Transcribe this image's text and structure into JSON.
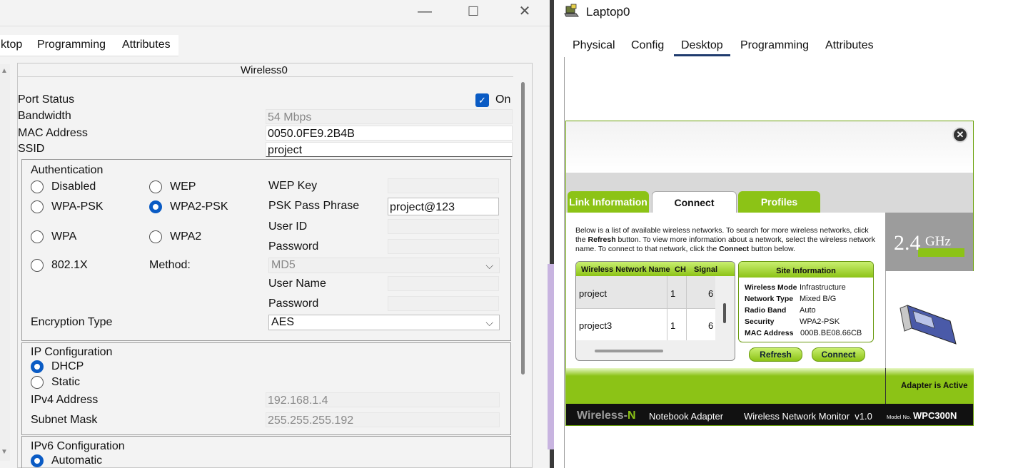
{
  "left_window": {
    "controls": {
      "minimize": "—",
      "maximize": "☐",
      "close": "✕"
    },
    "tabs": [
      "ktop",
      "Programming",
      "Attributes"
    ],
    "panel_title": "Wireless0",
    "port_status": {
      "label": "Port Status",
      "checked": true,
      "value": "On"
    },
    "bandwidth": {
      "label": "Bandwidth",
      "value": "54 Mbps"
    },
    "mac": {
      "label": "MAC Address",
      "value": "0050.0FE9.2B4B"
    },
    "ssid": {
      "label": "SSID",
      "value": "project"
    },
    "auth": {
      "title": "Authentication",
      "options": [
        "Disabled",
        "WEP",
        "WPA-PSK",
        "WPA2-PSK",
        "WPA",
        "WPA2",
        "802.1X"
      ],
      "selected": "WPA2-PSK",
      "wep_key_label": "WEP Key",
      "psk_label": "PSK Pass Phrase",
      "psk_value": "project@123",
      "user_id_label": "User ID",
      "password_label": "Password",
      "method_label": "Method:",
      "method_value": "MD5",
      "user_name_label": "User Name",
      "password2_label": "Password"
    },
    "encryption": {
      "label": "Encryption Type",
      "value": "AES"
    },
    "ip_config": {
      "title": "IP Configuration",
      "dhcp": "DHCP",
      "static": "Static",
      "selected": "DHCP",
      "ipv4_label": "IPv4 Address",
      "ipv4_value": "192.168.1.4",
      "mask_label": "Subnet Mask",
      "mask_value": "255.255.255.192"
    },
    "ipv6_config": {
      "title": "IPv6 Configuration",
      "automatic": "Automatic"
    }
  },
  "right_window": {
    "title": "Laptop0",
    "tabs": [
      "Physical",
      "Config",
      "Desktop",
      "Programming",
      "Attributes"
    ],
    "active_tab": "Desktop",
    "monitor": {
      "tabs": [
        "Link Information",
        "Connect",
        "Profiles"
      ],
      "active_tab": "Connect",
      "intro_1": "Below is a list of available wireless networks. To search for more wireless networks, click the ",
      "intro_refresh": "Refresh",
      "intro_2": " button. To view more information about a network, select the wireless network name. To connect to that network, click the ",
      "intro_connect": "Connect",
      "intro_3": " button below.",
      "table_headers": [
        "Wireless Network Name",
        "CH",
        "Signal"
      ],
      "networks": [
        {
          "name": "project",
          "ch": "1",
          "signal": "6"
        },
        {
          "name": "project3",
          "ch": "1",
          "signal": "6"
        }
      ],
      "site_info": {
        "title": "Site Information",
        "rows": [
          {
            "k": "Wireless Mode",
            "v": "Infrastructure"
          },
          {
            "k": "Network Type",
            "v": "Mixed B/G"
          },
          {
            "k": "Radio Band",
            "v": "Auto"
          },
          {
            "k": "Security",
            "v": "WPA2-PSK"
          },
          {
            "k": "MAC Address",
            "v": "000B.BE08.66CB"
          }
        ]
      },
      "refresh_btn": "Refresh",
      "connect_btn": "Connect",
      "ghz_num": "2.4",
      "ghz_unit": "GHz",
      "adapter_status": "Adapter is Active",
      "footer_brand_a": "Wireless-",
      "footer_brand_b": "N",
      "footer_product": "Notebook Adapter",
      "footer_app": "Wireless Network Monitor  v1.0",
      "footer_model_label": "Model No.",
      "footer_model": "WPC300N"
    }
  },
  "colors": {
    "accent_blue": "#0a5bc4",
    "linksys_green": "#8cc316",
    "footer_black": "#111111"
  }
}
